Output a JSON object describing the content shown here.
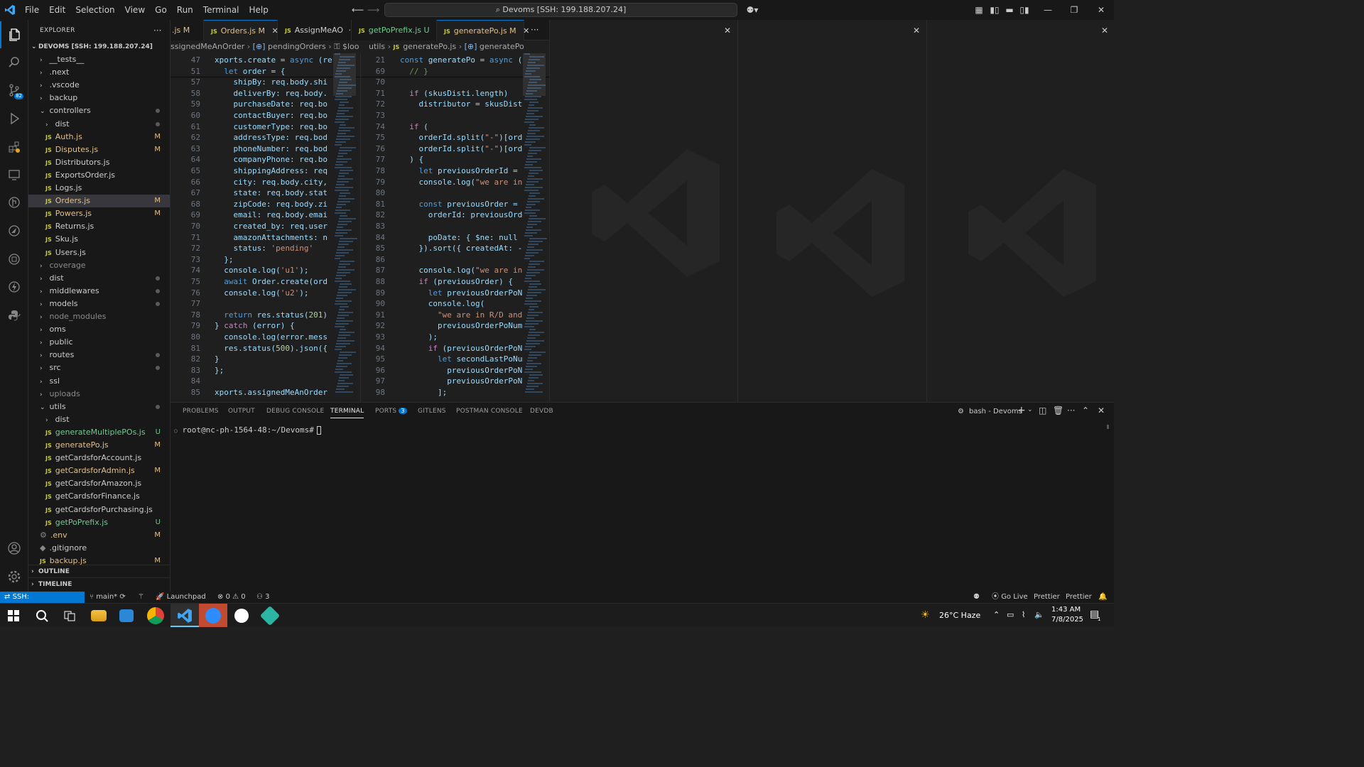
{
  "titlebar": {
    "menu": [
      "File",
      "Edit",
      "Selection",
      "View",
      "Go",
      "Run",
      "Terminal",
      "Help"
    ],
    "command_center": "Devoms [SSH: 199.188.207.24]"
  },
  "activity_bar": {
    "items": [
      "explorer-icon",
      "search-icon",
      "source-control-icon",
      "run-debug-icon",
      "extensions-icon",
      "remote-explorer-icon",
      "gitlens-icon",
      "postman-icon",
      "docker-icon",
      "thunder-client-icon",
      "python-icon"
    ],
    "scm_badge": "82",
    "bottom": [
      "accounts-icon",
      "settings-gear-icon"
    ]
  },
  "explorer": {
    "title": "EXPLORER",
    "root": "DEVOMS [SSH: 199.188.207.24]",
    "items": [
      {
        "label": "__tests__",
        "kind": "folder",
        "depth": 1,
        "open": false,
        "status": ""
      },
      {
        "label": ".next",
        "kind": "folder",
        "depth": 1,
        "open": false,
        "status": ""
      },
      {
        "label": ".vscode",
        "kind": "folder",
        "depth": 1,
        "open": false,
        "status": ""
      },
      {
        "label": "backup",
        "kind": "folder",
        "depth": 1,
        "open": false,
        "status": ""
      },
      {
        "label": "controllers",
        "kind": "folder",
        "depth": 1,
        "open": true,
        "status": "dot"
      },
      {
        "label": "dist",
        "kind": "folder",
        "depth": 2,
        "open": false,
        "status": "dot"
      },
      {
        "label": "Auth.js",
        "kind": "js",
        "depth": 2,
        "status": "M"
      },
      {
        "label": "Disputes.js",
        "kind": "js",
        "depth": 2,
        "status": "M"
      },
      {
        "label": "Distributors.js",
        "kind": "js",
        "depth": 2,
        "status": ""
      },
      {
        "label": "ExportsOrder.js",
        "kind": "js",
        "depth": 2,
        "status": ""
      },
      {
        "label": "Logs.js",
        "kind": "js",
        "depth": 2,
        "status": ""
      },
      {
        "label": "Orders.js",
        "kind": "js",
        "depth": 2,
        "status": "M",
        "selected": true
      },
      {
        "label": "Powers.js",
        "kind": "js",
        "depth": 2,
        "status": "M"
      },
      {
        "label": "Returns.js",
        "kind": "js",
        "depth": 2,
        "status": ""
      },
      {
        "label": "Sku.js",
        "kind": "js",
        "depth": 2,
        "status": ""
      },
      {
        "label": "Users.js",
        "kind": "js",
        "depth": 2,
        "status": ""
      },
      {
        "label": "coverage",
        "kind": "folder",
        "depth": 1,
        "open": false,
        "status": "ign"
      },
      {
        "label": "dist",
        "kind": "folder",
        "depth": 1,
        "open": false,
        "status": "dot"
      },
      {
        "label": "middlewares",
        "kind": "folder",
        "depth": 1,
        "open": false,
        "status": "dot"
      },
      {
        "label": "models",
        "kind": "folder",
        "depth": 1,
        "open": false,
        "status": "dot"
      },
      {
        "label": "node_modules",
        "kind": "folder",
        "depth": 1,
        "open": false,
        "status": "ign"
      },
      {
        "label": "oms",
        "kind": "folder",
        "depth": 1,
        "open": false,
        "status": ""
      },
      {
        "label": "public",
        "kind": "folder",
        "depth": 1,
        "open": false,
        "status": ""
      },
      {
        "label": "routes",
        "kind": "folder",
        "depth": 1,
        "open": false,
        "status": "dot"
      },
      {
        "label": "src",
        "kind": "folder",
        "depth": 1,
        "open": false,
        "status": "dot"
      },
      {
        "label": "ssl",
        "kind": "folder",
        "depth": 1,
        "open": false,
        "status": ""
      },
      {
        "label": "uploads",
        "kind": "folder",
        "depth": 1,
        "open": false,
        "status": "ign"
      },
      {
        "label": "utils",
        "kind": "folder",
        "depth": 1,
        "open": true,
        "status": "dot"
      },
      {
        "label": "dist",
        "kind": "folder",
        "depth": 2,
        "open": false,
        "status": ""
      },
      {
        "label": "generateMultiplePOs.js",
        "kind": "js",
        "depth": 2,
        "status": "U"
      },
      {
        "label": "generatePo.js",
        "kind": "js",
        "depth": 2,
        "status": "M"
      },
      {
        "label": "getCardsforAccount.js",
        "kind": "js",
        "depth": 2,
        "status": ""
      },
      {
        "label": "getCardsforAdmin.js",
        "kind": "js",
        "depth": 2,
        "status": "M"
      },
      {
        "label": "getCardsforAmazon.js",
        "kind": "js",
        "depth": 2,
        "status": ""
      },
      {
        "label": "getCardsforFinance.js",
        "kind": "js",
        "depth": 2,
        "status": ""
      },
      {
        "label": "getCardsforPurchasing.js",
        "kind": "js",
        "depth": 2,
        "status": ""
      },
      {
        "label": "getPoPrefix.js",
        "kind": "js",
        "depth": 2,
        "status": "U"
      },
      {
        "label": ".env",
        "kind": "gear",
        "depth": 1,
        "status": "M"
      },
      {
        "label": ".gitignore",
        "kind": "plain",
        "depth": 1,
        "status": ""
      },
      {
        "label": "backup.js",
        "kind": "js",
        "depth": 1,
        "status": "M"
      }
    ],
    "outline": "OUTLINE",
    "timeline": "TIMELINE"
  },
  "tabs": [
    {
      "label": ".js M",
      "clipped": true
    },
    {
      "label": "Orders.js",
      "status": "M",
      "active": true
    },
    {
      "label": "AssignMeAO",
      "status": ""
    },
    {
      "label": "getPoPrefix.js",
      "status": "U"
    },
    {
      "label": "generatePo.js",
      "status": "M",
      "active": true
    }
  ],
  "breadcrumb_left": [
    "ssignedMeAnOrder",
    "pendingOrders",
    "$lookup"
  ],
  "breadcrumb_right": [
    "utils",
    "generatePo.js",
    "generatePo"
  ],
  "editor_left": {
    "sticky": [
      {
        "n": "47",
        "t": "xports.create = async (re"
      },
      {
        "n": "51",
        "t": "  let order = {"
      }
    ],
    "lines": [
      {
        "n": "57",
        "t": "    shipBy: req.body.shi"
      },
      {
        "n": "58",
        "t": "    deliverBy: req.body."
      },
      {
        "n": "59",
        "t": "    purchaseDate: req.bo"
      },
      {
        "n": "60",
        "t": "    contactBuyer: req.bo"
      },
      {
        "n": "61",
        "t": "    customerType: req.bo"
      },
      {
        "n": "62",
        "t": "    addressType: req.bod"
      },
      {
        "n": "63",
        "t": "    phoneNumber: req.bod"
      },
      {
        "n": "64",
        "t": "    companyPhone: req.bo"
      },
      {
        "n": "65",
        "t": "    shippingAddress: req"
      },
      {
        "n": "66",
        "t": "    city: req.body.city,"
      },
      {
        "n": "67",
        "t": "    state: req.body.stat"
      },
      {
        "n": "68",
        "t": "    zipCode: req.body.zi"
      },
      {
        "n": "69",
        "t": "    email: req.body.emai"
      },
      {
        "n": "70",
        "t": "    created_by: req.user"
      },
      {
        "n": "71",
        "t": "    amazonAttachments: n"
      },
      {
        "n": "72",
        "t": "    status: 'pending'"
      },
      {
        "n": "73",
        "t": "  };"
      },
      {
        "n": "74",
        "t": "  console.log('u1');"
      },
      {
        "n": "75",
        "t": "  await Order.create(ord"
      },
      {
        "n": "76",
        "t": "  console.log('u2');"
      },
      {
        "n": "77",
        "t": ""
      },
      {
        "n": "78",
        "t": "  return res.status(201)"
      },
      {
        "n": "79",
        "t": "} catch (error) {"
      },
      {
        "n": "80",
        "t": "  console.log(error.mess"
      },
      {
        "n": "81",
        "t": "  res.status(500).json({"
      },
      {
        "n": "82",
        "t": "}"
      },
      {
        "n": "83",
        "t": "};"
      },
      {
        "n": "84",
        "t": ""
      },
      {
        "n": "85",
        "t": "xports.assignedMeAnOrder"
      }
    ]
  },
  "editor_right": {
    "sticky": [
      {
        "n": "21",
        "t": "const generatePo = async (c"
      },
      {
        "n": "69",
        "t": "  // }"
      }
    ],
    "lines": [
      {
        "n": "70",
        "t": ""
      },
      {
        "n": "71",
        "t": "  if (skusDisti.length)"
      },
      {
        "n": "72",
        "t": "    distributor = skusDisti"
      },
      {
        "n": "73",
        "t": ""
      },
      {
        "n": "74",
        "t": "  if ("
      },
      {
        "n": "75",
        "t": "    orderId.split(\"-\")[orde"
      },
      {
        "n": "76",
        "t": "    orderId.split(\"-\")[orde"
      },
      {
        "n": "77",
        "t": "  ) {"
      },
      {
        "n": "78",
        "t": "    let previousOrderId = o"
      },
      {
        "n": "79",
        "t": "    console.log(\"we are in "
      },
      {
        "n": "80",
        "t": ""
      },
      {
        "n": "81",
        "t": "    const previousOrder = a"
      },
      {
        "n": "82",
        "t": "      orderId: previousOrde"
      },
      {
        "n": "83",
        "t": ""
      },
      {
        "n": "84",
        "t": "      poDate: { $ne: null }"
      },
      {
        "n": "85",
        "t": "    }).sort({ createdAt: -1"
      },
      {
        "n": "86",
        "t": ""
      },
      {
        "n": "87",
        "t": "    console.log(\"we are in "
      },
      {
        "n": "88",
        "t": "    if (previousOrder) {"
      },
      {
        "n": "89",
        "t": "      let previousOrderPoNu"
      },
      {
        "n": "90",
        "t": "      console.log("
      },
      {
        "n": "91",
        "t": "        \"we are in R/D and "
      },
      {
        "n": "92",
        "t": "        previousOrderPoNumb"
      },
      {
        "n": "93",
        "t": "      );"
      },
      {
        "n": "94",
        "t": "      if (previousOrderPoNu"
      },
      {
        "n": "95",
        "t": "        let secondLastPoNum"
      },
      {
        "n": "96",
        "t": "          previousOrderPoNu"
      },
      {
        "n": "97",
        "t": "          previousOrderPoNu"
      },
      {
        "n": "98",
        "t": "        ];"
      }
    ]
  },
  "panel": {
    "tabs": [
      "PROBLEMS",
      "OUTPUT",
      "DEBUG CONSOLE",
      "TERMINAL",
      "PORTS",
      "GITLENS",
      "POSTMAN CONSOLE",
      "DEVDB"
    ],
    "active_tab": "TERMINAL",
    "ports_badge": "3",
    "terminal_name": "bash - Devoms",
    "prompt": "root@nc-ph-1564-48:~/Devoms#"
  },
  "statusbar": {
    "remote": "SSH: 199.188.207.24",
    "branch": "main*",
    "launchpad": "Launchpad",
    "errors": "0",
    "warnings": "0",
    "ports": "3",
    "golive": "Go Live",
    "prettier1": "Prettier",
    "prettier2": "Prettier"
  },
  "taskbar": {
    "weather": "26°C  Haze",
    "time": "1:43 AM",
    "date": "7/8/2025",
    "notif_badge": "1"
  },
  "colors": {
    "accent": "#0078d4",
    "bg": "#1f1f1f",
    "sidebar": "#181818"
  }
}
